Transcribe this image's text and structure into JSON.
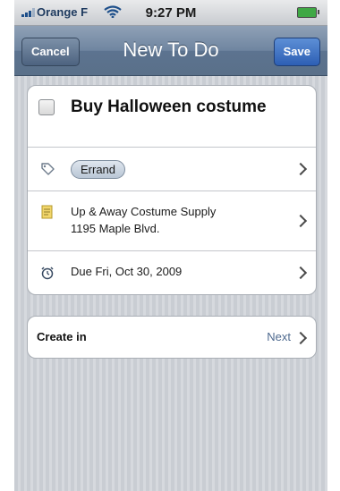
{
  "status_bar": {
    "carrier": "Orange F",
    "time": "9:27 PM",
    "signal_icon": "signal-bars-icon",
    "wifi_icon": "wifi-icon",
    "battery_icon": "battery-icon"
  },
  "nav": {
    "title": "New To Do",
    "cancel_label": "Cancel",
    "save_label": "Save"
  },
  "todo": {
    "title": "Buy Halloween costume",
    "completed": false
  },
  "tag": {
    "icon": "tag-icon",
    "label": "Errand"
  },
  "location": {
    "icon": "note-icon",
    "name": "Up & Away Costume Supply",
    "address": "1195 Maple Blvd."
  },
  "due": {
    "icon": "alarm-clock-icon",
    "label": "Due Fri, Oct 30, 2009"
  },
  "create_in": {
    "label": "Create in",
    "value": "Next"
  },
  "colors": {
    "nav_bar": "#6f85a0",
    "save_button": "#2d5fb4",
    "link_text": "#4f6a8f",
    "background_stripes": "#c9cdd3"
  }
}
